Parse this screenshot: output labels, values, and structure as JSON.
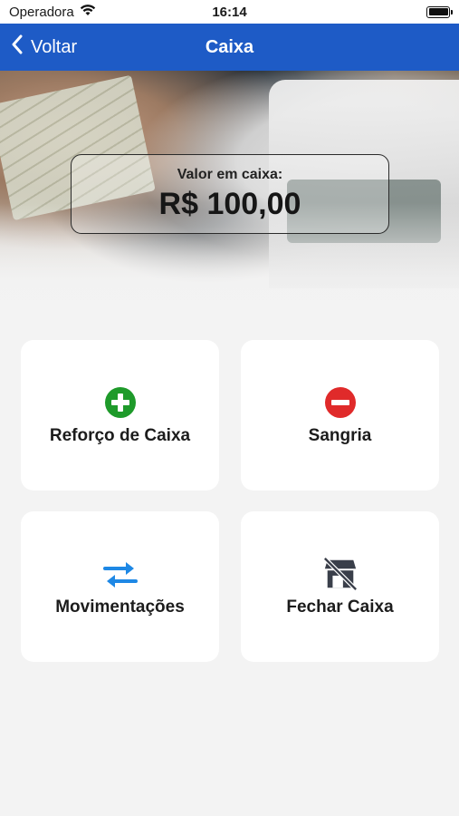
{
  "status_bar": {
    "carrier": "Operadora",
    "time": "16:14"
  },
  "nav": {
    "back_label": "Voltar",
    "title": "Caixa"
  },
  "balance": {
    "label": "Valor em caixa:",
    "value": "R$ 100,00"
  },
  "actions": [
    {
      "label": "Reforço de Caixa",
      "icon": "plus-circle-icon",
      "color": "#1e9a2a"
    },
    {
      "label": "Sangria",
      "icon": "minus-circle-icon",
      "color": "#e02a2a"
    },
    {
      "label": "Movimentações",
      "icon": "arrows-exchange-icon",
      "color": "#1e88e5"
    },
    {
      "label": "Fechar Caixa",
      "icon": "store-closed-icon",
      "color": "#3a3f4a"
    }
  ],
  "colors": {
    "nav_background": "#1e5bc6",
    "page_background": "#f3f3f3"
  }
}
